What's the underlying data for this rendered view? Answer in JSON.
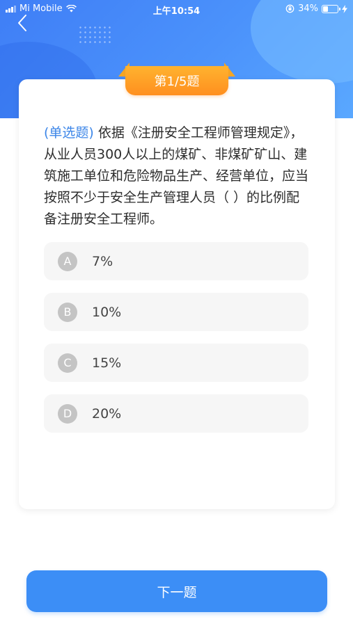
{
  "status_bar": {
    "carrier": "Mi Mobile",
    "time": "上午10:54",
    "battery": "34%",
    "battery_level": 0.34,
    "icons": [
      "signal-icon",
      "wifi-icon",
      "orientation-lock-icon",
      "battery-icon",
      "charging-icon"
    ]
  },
  "nav": {
    "back_icon": "chevron-left-icon"
  },
  "question": {
    "badge": "第1/5题",
    "type_label": "(单选题)",
    "text": " 依据《注册安全工程师管理规定》，从业人员300人以上的煤矿、非煤矿矿山、建筑施工单位和危险物品生产、经营单位，应当按照不少于安全生产管理人员（ ）的比例配备注册安全工程师。"
  },
  "options": [
    {
      "letter": "A",
      "text": "7%"
    },
    {
      "letter": "B",
      "text": "10%"
    },
    {
      "letter": "C",
      "text": "15%"
    },
    {
      "letter": "D",
      "text": "20%"
    }
  ],
  "footer": {
    "next_label": "下一题"
  },
  "colors": {
    "header_blue": "#4b92fb",
    "badge_orange": "#ff9f26",
    "question_type_blue": "#3c86e8",
    "button_blue": "#3c8ef6",
    "option_circle_gray": "#c4c4c4"
  }
}
